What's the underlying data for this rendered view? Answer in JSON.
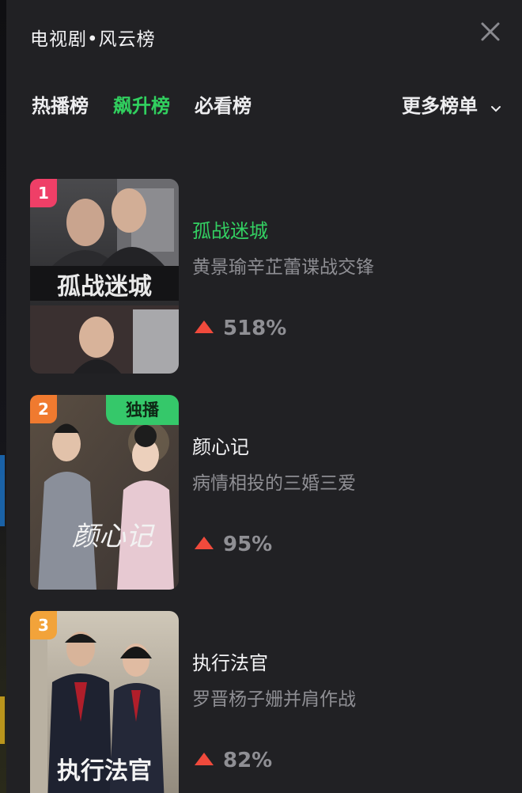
{
  "header": {
    "title": "电视剧•风云榜",
    "close_icon": "close-icon"
  },
  "tabs": [
    {
      "label": "热播榜",
      "active": false
    },
    {
      "label": "飙升榜",
      "active": true
    },
    {
      "label": "必看榜",
      "active": false
    }
  ],
  "more": {
    "label": "更多榜单",
    "icon": "chevron-down-icon"
  },
  "colors": {
    "accent": "#31d05f",
    "rank1": "#ef3f67",
    "rank2": "#f07a2f",
    "rank3": "#f2a33a",
    "trend_up": "#f04a3c"
  },
  "items": [
    {
      "rank": "1",
      "title": "孤战迷城",
      "subtitle": "黄景瑜辛芷蕾谍战交锋",
      "change": "518%",
      "poster_caption": "孤战迷城",
      "highlighted": true
    },
    {
      "rank": "2",
      "badge": "独播",
      "title": "颜心记",
      "subtitle": "病情相投的三婚三爱",
      "change": "95%",
      "poster_caption": "颜心记",
      "highlighted": false
    },
    {
      "rank": "3",
      "title": "执行法官",
      "subtitle": "罗晋杨子姗并肩作战",
      "change": "82%",
      "poster_caption": "执行法官",
      "highlighted": false
    }
  ]
}
